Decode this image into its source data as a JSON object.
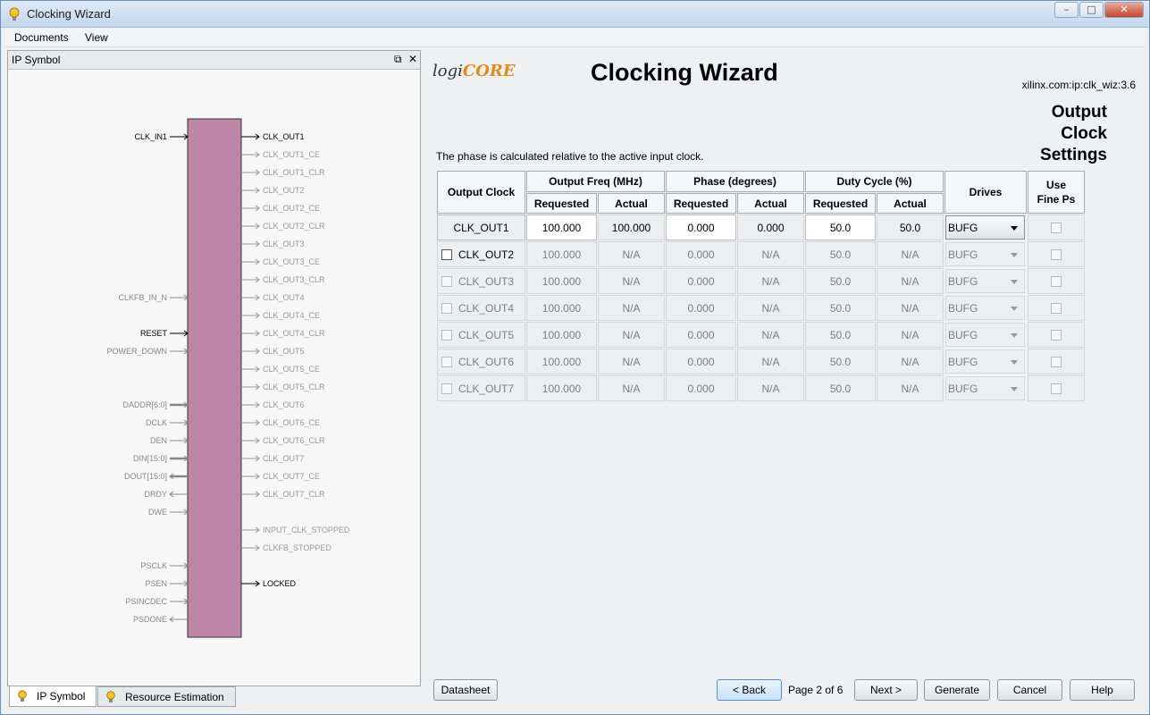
{
  "window": {
    "title": "Clocking Wizard"
  },
  "menu": [
    {
      "label": "Documents"
    },
    {
      "label": "View"
    }
  ],
  "left_panel": {
    "title": "IP Symbol",
    "restore_icon": "restore-icon",
    "close_icon": "close-icon",
    "symbol": {
      "left_pins": [
        {
          "label": "CLK_IN1",
          "active": true
        },
        {
          "label": "CLKFB_IN_N",
          "active": false
        },
        {
          "label": "RESET",
          "active": true
        },
        {
          "label": "POWER_DOWN",
          "active": false
        },
        {
          "label": "DADDR[6:0]",
          "active": false
        },
        {
          "label": "DCLK",
          "active": false
        },
        {
          "label": "DEN",
          "active": false
        },
        {
          "label": "DIN[15:0]",
          "active": false
        },
        {
          "label": "DOUT[15:0]",
          "active": false
        },
        {
          "label": "DRDY",
          "active": false
        },
        {
          "label": "DWE",
          "active": false
        },
        {
          "label": "PSCLK",
          "active": false
        },
        {
          "label": "PSEN",
          "active": false
        },
        {
          "label": "PSINCDEC",
          "active": false
        },
        {
          "label": "PSDONE",
          "active": false
        }
      ],
      "right_pins": [
        {
          "label": "CLK_OUT1",
          "active": true
        },
        {
          "label": "CLK_OUT1_CE",
          "active": false
        },
        {
          "label": "CLK_OUT1_CLR",
          "active": false
        },
        {
          "label": "CLK_OUT2",
          "active": false
        },
        {
          "label": "CLK_OUT2_CE",
          "active": false
        },
        {
          "label": "CLK_OUT2_CLR",
          "active": false
        },
        {
          "label": "CLK_OUT3",
          "active": false
        },
        {
          "label": "CLK_OUT3_CE",
          "active": false
        },
        {
          "label": "CLK_OUT3_CLR",
          "active": false
        },
        {
          "label": "CLK_OUT4",
          "active": false
        },
        {
          "label": "CLK_OUT4_CE",
          "active": false
        },
        {
          "label": "CLK_OUT4_CLR",
          "active": false
        },
        {
          "label": "CLK_OUT5",
          "active": false
        },
        {
          "label": "CLK_OUT5_CE",
          "active": false
        },
        {
          "label": "CLK_OUT5_CLR",
          "active": false
        },
        {
          "label": "CLK_OUT6",
          "active": false
        },
        {
          "label": "CLK_OUT6_CE",
          "active": false
        },
        {
          "label": "CLK_OUT6_CLR",
          "active": false
        },
        {
          "label": "CLK_OUT7",
          "active": false
        },
        {
          "label": "CLK_OUT7_CE",
          "active": false
        },
        {
          "label": "CLK_OUT7_CLR",
          "active": false
        },
        {
          "label": "INPUT_CLK_STOPPED",
          "active": false
        },
        {
          "label": "CLKFB_STOPPED",
          "active": false
        },
        {
          "label": "LOCKED",
          "active": true
        }
      ]
    }
  },
  "bottom_tabs": [
    {
      "label": "IP Symbol"
    },
    {
      "label": "Resource Estimation"
    }
  ],
  "main": {
    "logo_text": "logi",
    "logo_core": "CORE",
    "title": "Clocking Wizard",
    "vendor_id": "xilinx.com:ip:clk_wiz:3.6",
    "section_title_lines": [
      "Output",
      "Clock",
      "Settings"
    ],
    "info": "The phase is calculated relative to the active input clock.",
    "table": {
      "headers": {
        "output_clock": "Output Clock",
        "output_freq": "Output Freq (MHz)",
        "phase": "Phase (degrees)",
        "duty": "Duty Cycle (%)",
        "drives": "Drives",
        "use_fine_ps_1": "Use",
        "use_fine_ps_2": "Fine Ps",
        "requested": "Requested",
        "actual": "Actual"
      },
      "rows": [
        {
          "name": "CLK_OUT1",
          "freq_req": "100.000",
          "freq_act": "100.000",
          "phase_req": "0.000",
          "phase_act": "0.000",
          "duty_req": "50.0",
          "duty_act": "50.0",
          "drives": "BUFG"
        },
        {
          "name": "CLK_OUT2",
          "freq_req": "100.000",
          "freq_act": "N/A",
          "phase_req": "0.000",
          "phase_act": "N/A",
          "duty_req": "50.0",
          "duty_act": "N/A",
          "drives": "BUFG"
        },
        {
          "name": "CLK_OUT3",
          "freq_req": "100.000",
          "freq_act": "N/A",
          "phase_req": "0.000",
          "phase_act": "N/A",
          "duty_req": "50.0",
          "duty_act": "N/A",
          "drives": "BUFG"
        },
        {
          "name": "CLK_OUT4",
          "freq_req": "100.000",
          "freq_act": "N/A",
          "phase_req": "0.000",
          "phase_act": "N/A",
          "duty_req": "50.0",
          "duty_act": "N/A",
          "drives": "BUFG"
        },
        {
          "name": "CLK_OUT5",
          "freq_req": "100.000",
          "freq_act": "N/A",
          "phase_req": "0.000",
          "phase_act": "N/A",
          "duty_req": "50.0",
          "duty_act": "N/A",
          "drives": "BUFG"
        },
        {
          "name": "CLK_OUT6",
          "freq_req": "100.000",
          "freq_act": "N/A",
          "phase_req": "0.000",
          "phase_act": "N/A",
          "duty_req": "50.0",
          "duty_act": "N/A",
          "drives": "BUFG"
        },
        {
          "name": "CLK_OUT7",
          "freq_req": "100.000",
          "freq_act": "N/A",
          "phase_req": "0.000",
          "phase_act": "N/A",
          "duty_req": "50.0",
          "duty_act": "N/A",
          "drives": "BUFG"
        }
      ]
    }
  },
  "footer": {
    "datasheet": "Datasheet",
    "back": "< Back",
    "page_info": "Page 2 of 6",
    "next": "Next >",
    "generate": "Generate",
    "cancel": "Cancel",
    "help": "Help"
  },
  "colors": {
    "symbol_body": "#bd86a7",
    "accent": "#4f8fd6"
  }
}
